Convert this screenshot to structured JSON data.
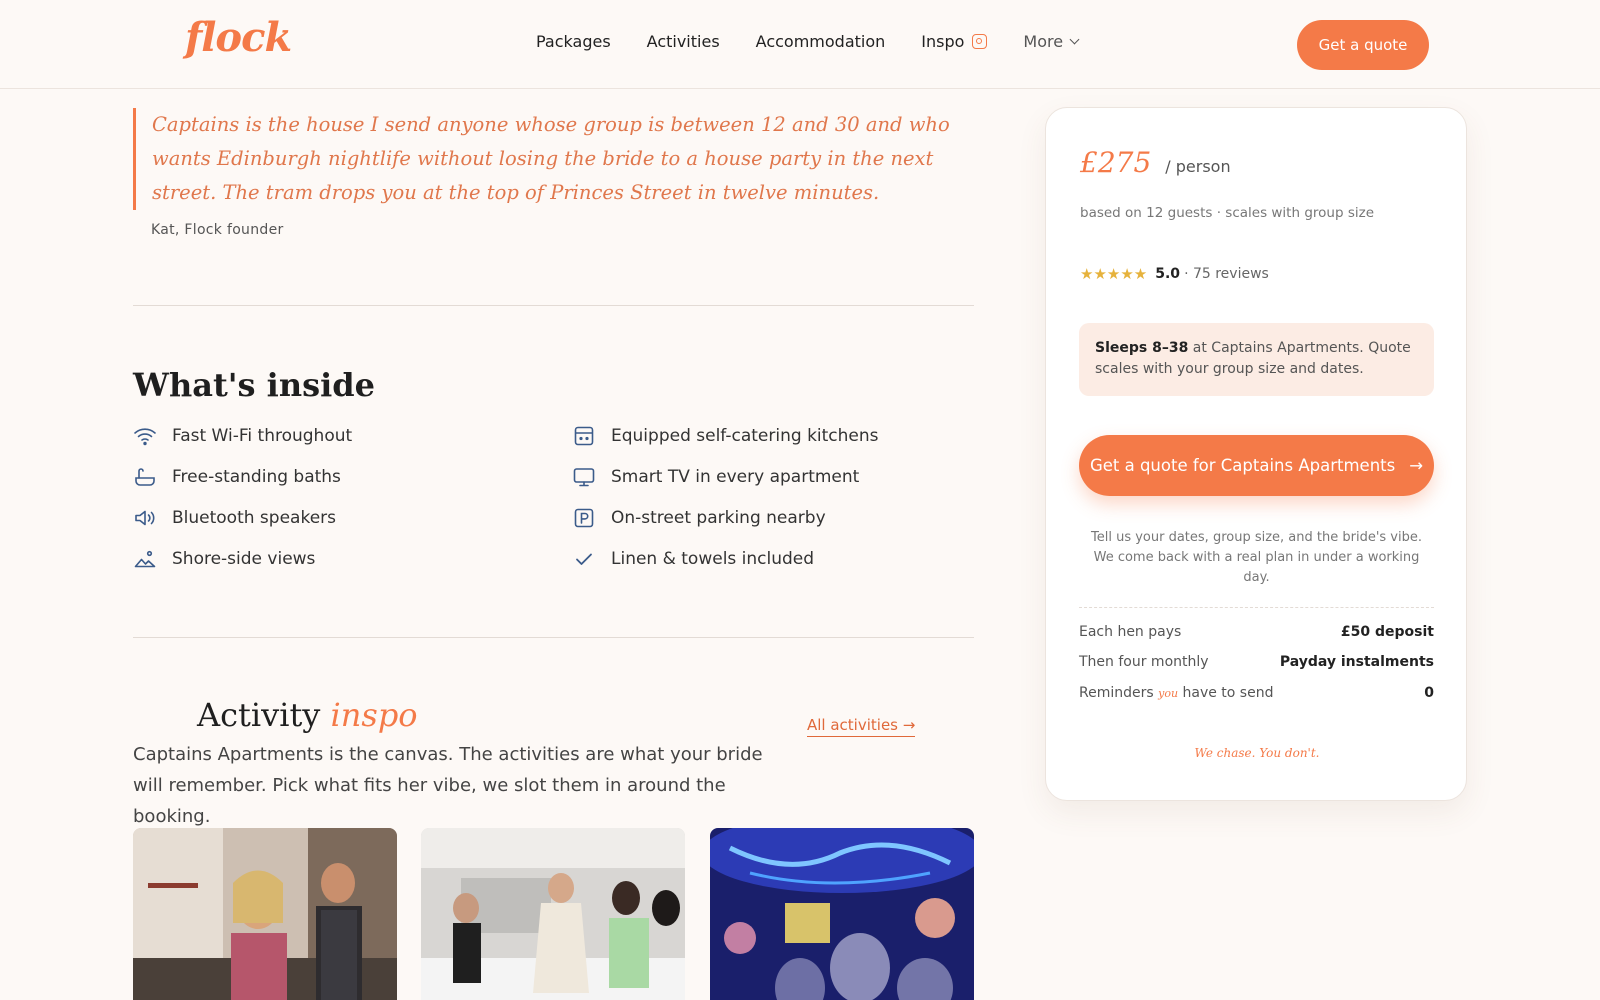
{
  "brand": {
    "logo": "flock",
    "accent": "#f47a48"
  },
  "nav": {
    "items": [
      "Packages",
      "Activities",
      "Accommodation",
      "Inspo",
      "More"
    ],
    "cta": "Get a quote",
    "icons": {
      "inspo": "instagram-icon",
      "more": "chevron-down-icon"
    }
  },
  "quote": {
    "text": "Captains is the house I send anyone whose group is between 12 and 30 and who wants Edinburgh nightlife without losing the bride to a house party in the next street. The tram drops you at the top of Princes Street in twelve minutes.",
    "author": "Kat, Flock founder"
  },
  "inside": {
    "title": "What's inside",
    "items": [
      {
        "label": "Fast Wi-Fi throughout",
        "icon": "wifi-icon"
      },
      {
        "label": "Equipped self-catering kitchens",
        "icon": "kitchen-icon"
      },
      {
        "label": "Free-standing baths",
        "icon": "bath-icon"
      },
      {
        "label": "Smart TV in every apartment",
        "icon": "tv-icon"
      },
      {
        "label": "Bluetooth speakers",
        "icon": "speaker-icon"
      },
      {
        "label": "On-street parking nearby",
        "icon": "parking-icon"
      },
      {
        "label": "Shore-side views",
        "icon": "landscape-icon"
      },
      {
        "label": "Linen & towels included",
        "icon": "check-icon"
      }
    ]
  },
  "activity": {
    "title": "Activity",
    "title_accent": "inspo",
    "link": "All activities →",
    "description": "Captains Apartments is the canvas. The activities are what your bride will remember. Pick what fits her vibe, we slot them in around the booking."
  },
  "card": {
    "price": "£275",
    "per": "/ person",
    "basis": "based on 12 guests · scales with group size",
    "stars": "★★★★★",
    "score": "5.0",
    "reviews": "· 75 reviews",
    "sleeps_bold": "Sleeps 8–38",
    "sleeps_rest": " at Captains Apartments. Quote scales with your group size and dates.",
    "cta": "Get a quote for Captains Apartments",
    "cta_arrow": "→",
    "note": "Tell us your dates, group size, and the bride's vibe. We come back with a real plan in under a working day.",
    "payments": {
      "row1": {
        "k": "Each hen pays",
        "v": "£50 deposit"
      },
      "row2": {
        "k": "Then four monthly",
        "v": "Payday instalments"
      },
      "row3": {
        "k_pre": "Reminders ",
        "k_em": "you",
        "k_post": " have to send",
        "v": "0"
      }
    },
    "footer": "We chase. You don't."
  }
}
